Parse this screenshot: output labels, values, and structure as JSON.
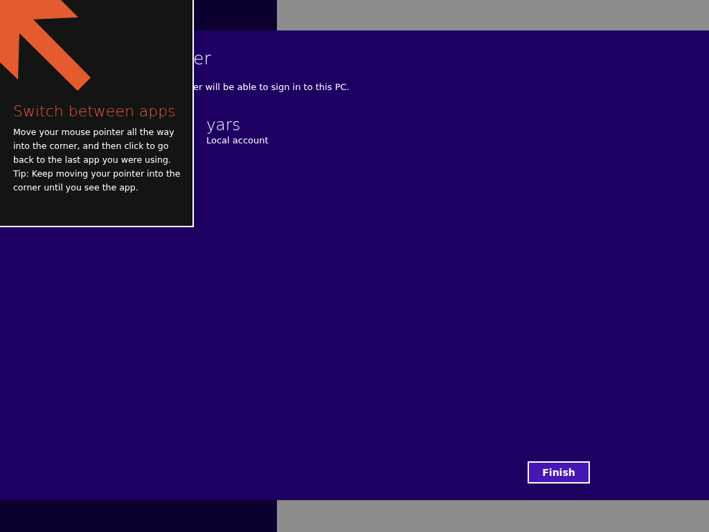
{
  "page": {
    "heading": "er",
    "subtitle": "er will be able to sign in to this PC."
  },
  "account": {
    "name": "yars",
    "type": "Local account"
  },
  "buttons": [
    {
      "label": "Finish"
    }
  ],
  "tip": {
    "title": "Switch between apps",
    "body": [
      "Move your mouse pointer all the way into the corner, and then click to go back to the last app you were using.",
      "Tip: Keep moving your pointer into the corner until you see the app."
    ]
  }
}
